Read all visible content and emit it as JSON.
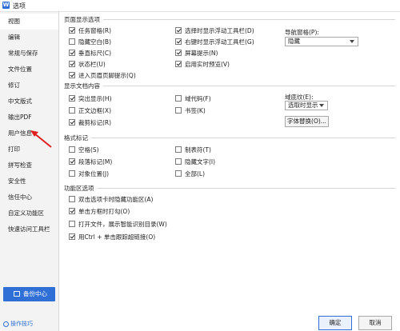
{
  "window": {
    "title": "选项",
    "icon_char": "W"
  },
  "sidebar": {
    "items": [
      {
        "label": "视图",
        "active": true
      },
      {
        "label": "编辑"
      },
      {
        "label": "常规与保存"
      },
      {
        "label": "文件位置"
      },
      {
        "label": "修订"
      },
      {
        "label": "中文版式"
      },
      {
        "label": "输出PDF"
      },
      {
        "label": "用户信息"
      },
      {
        "label": "打印"
      },
      {
        "label": "拼写检查"
      },
      {
        "label": "安全性"
      },
      {
        "label": "信任中心"
      },
      {
        "label": "自定义功能区"
      },
      {
        "label": "快速访问工具栏"
      }
    ],
    "backup_label": "备份中心",
    "tips_label": "操作技巧"
  },
  "page_show": {
    "title": "页面显示选项",
    "col1": [
      {
        "label": "任务窗格(R)",
        "checked": true
      },
      {
        "label": "隐藏空白(B)",
        "checked": false
      },
      {
        "label": "垂直标尺(C)",
        "checked": true
      },
      {
        "label": "状态栏(U)",
        "checked": true
      },
      {
        "label": "进入页眉页脚提示(Q)",
        "checked": true
      }
    ],
    "col2": [
      {
        "label": "选择时显示浮动工具栏(D)",
        "checked": true
      },
      {
        "label": "右键时显示浮动工具栏(G)",
        "checked": true
      },
      {
        "label": "屏幕提示(N)",
        "checked": true
      },
      {
        "label": "启用实时预览(V)",
        "checked": true
      }
    ],
    "nav_label": "导航窗格(P):",
    "nav_value": "隐藏"
  },
  "doc_content": {
    "title": "显示文档内容",
    "col1": [
      {
        "label": "突出显示(H)",
        "checked": true
      },
      {
        "label": "正文边框(X)",
        "checked": false
      },
      {
        "label": "裁剪标记(R)",
        "checked": true
      }
    ],
    "col2": [
      {
        "label": "域代码(F)",
        "checked": false
      },
      {
        "label": "书签(K)",
        "checked": false
      }
    ],
    "shade_label": "域底纹(E):",
    "shade_value": "选取时显示",
    "font_replace": "字体替换(O)..."
  },
  "format_marks": {
    "title": "格式标记",
    "col1": [
      {
        "label": "空格(S)",
        "checked": false
      },
      {
        "label": "段落标记(M)",
        "checked": true
      },
      {
        "label": "对象位置(J)",
        "checked": false
      }
    ],
    "col2": [
      {
        "label": "制表符(T)",
        "checked": false
      },
      {
        "label": "隐藏文字(I)",
        "checked": false
      },
      {
        "label": "全部(L)",
        "checked": false
      }
    ]
  },
  "ribbon": {
    "title": "功能区选项",
    "items": [
      {
        "label": "双击选项卡时隐藏功能区(A)",
        "checked": false
      },
      {
        "label": "单击方框时打勾(O)",
        "checked": true
      },
      {
        "label": "打开文件，展示智能识别目录(W)",
        "checked": false
      },
      {
        "label": "用Ctrl + 单击跟踪超链接(O)",
        "checked": true
      }
    ]
  },
  "footer": {
    "ok": "确定",
    "cancel": "取消"
  },
  "colors": {
    "accent": "#2f6fd6",
    "annotation_arrow": "#e02020"
  }
}
